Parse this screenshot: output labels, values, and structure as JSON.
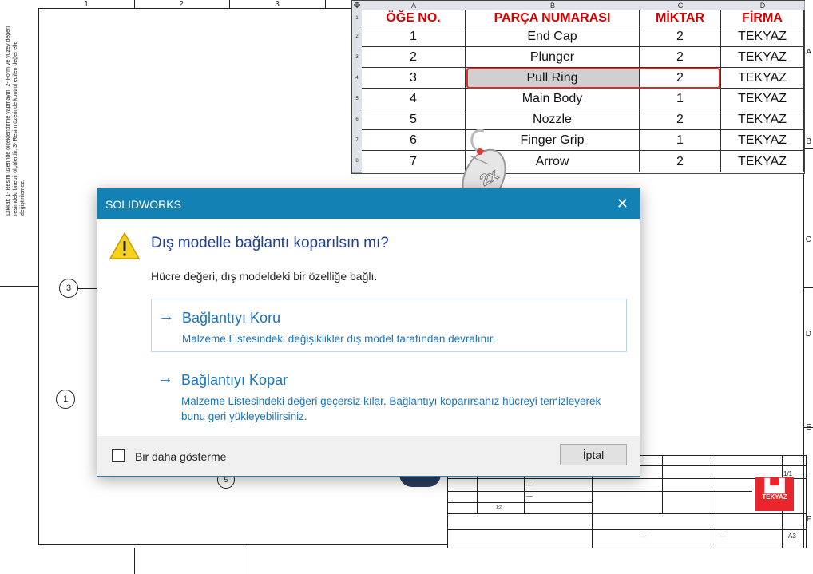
{
  "sheet": {
    "column_labels": [
      "1",
      "2",
      "3"
    ],
    "row_labels": [
      "A",
      "B",
      "C",
      "D",
      "E",
      "F"
    ],
    "notes": "Dikkat:\n1- Resim üzerinde ölçeklendirme yapmayın.\n2- Form ve yüzey değeri resimdeki birebir ölçülerdir.\n3- Resim üzerinde kontrol edilen değer elle değiştirilemez.",
    "balloons": [
      "3",
      "1",
      "5"
    ]
  },
  "bom": {
    "column_letters": [
      "A",
      "B",
      "C",
      "D"
    ],
    "row_numbers": [
      "1",
      "2",
      "3",
      "4",
      "5",
      "6",
      "7",
      "8"
    ],
    "headers": [
      "ÖĞE NO.",
      "PARÇA NUMARASI",
      "MİKTAR",
      "FİRMA"
    ],
    "rows": [
      [
        "1",
        "End Cap",
        "2",
        "TEKYAZ"
      ],
      [
        "2",
        "Plunger",
        "2",
        "TEKYAZ"
      ],
      [
        "3",
        "Pull Ring",
        "2",
        "TEKYAZ"
      ],
      [
        "4",
        "Main Body",
        "1",
        "TEKYAZ"
      ],
      [
        "5",
        "Nozzle",
        "2",
        "TEKYAZ"
      ],
      [
        "6",
        "Finger Grip",
        "1",
        "TEKYAZ"
      ],
      [
        "7",
        "Arrow",
        "2",
        "TEKYAZ"
      ]
    ],
    "highlight_color": "#d43030"
  },
  "mouse": {
    "label": "2x"
  },
  "title_block": {
    "sheet_count": "1/1",
    "format": "A3",
    "logo_text": "TEKYAZ",
    "logo_color": "#e8262b",
    "scale_value": "1:2",
    "dash": "—"
  },
  "dialog": {
    "window_title": "SOLIDWORKS",
    "question": "Dış modelle bağlantı koparılsın mı?",
    "info": "Hücre değeri, dış modeldeki bir özelliğe bağlı.",
    "options": [
      {
        "title": "Bağlantıyı Koru",
        "description": "Malzeme Listesindeki değişiklikler dış model tarafından devralınır."
      },
      {
        "title": "Bağlantıyı Kopar",
        "description": "Malzeme Listesindeki değeri geçersiz kılar. Bağlantıyı koparırsanız hücreyi temizleyerek bunu geri yükleyebilirsiniz."
      }
    ],
    "checkbox_label": "Bir daha gösterme",
    "cancel_label": "İptal",
    "accent_color": "#1481b5",
    "link_color": "#1a74bf"
  }
}
